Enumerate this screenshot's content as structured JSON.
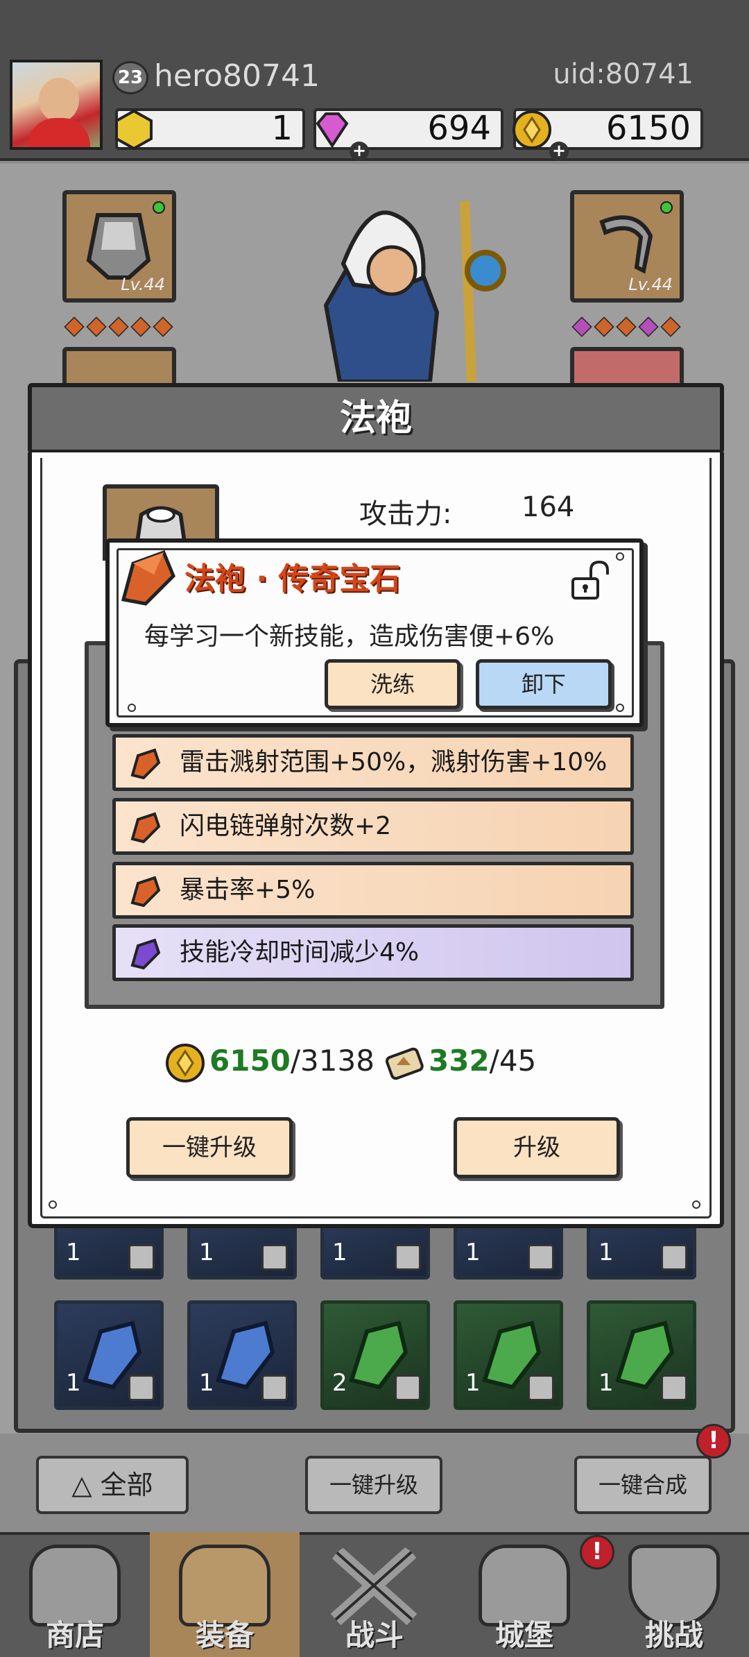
{
  "header": {
    "level": "23",
    "username": "hero80741",
    "uid": "uid:80741",
    "resources": [
      {
        "name": "stamina",
        "value": "1",
        "color": "#e9c832"
      },
      {
        "name": "gem",
        "value": "694",
        "color": "#d65ad0"
      },
      {
        "name": "gold",
        "value": "6150",
        "color": "#e5b21f"
      }
    ]
  },
  "equipment": {
    "left_slot_level": "Lv.44",
    "right_slot_level": "Lv.44"
  },
  "dialog": {
    "title": "法袍",
    "attack_label": "攻击力:",
    "attack_value": "164",
    "gem_popup": {
      "title": "法袍 · 传奇宝石",
      "description": "每学习一个新技能，造成伤害便+6%",
      "refine_label": "洗练",
      "unequip_label": "卸下"
    },
    "gem_rows": [
      {
        "text": "雷击溅射范围+50%，溅射伤害+10%",
        "rarity": "orange"
      },
      {
        "text": "闪电链弹射次数+2",
        "rarity": "orange"
      },
      {
        "text": "暴击率+5%",
        "rarity": "orange"
      },
      {
        "text": "技能冷却时间减少4%",
        "rarity": "purple"
      }
    ],
    "cost": {
      "gold_have": "6150",
      "gold_need": "/3138",
      "scroll_have": "332",
      "scroll_need": "/45"
    },
    "one_key_upgrade_label": "一键升级",
    "upgrade_label": "升级"
  },
  "inventory": {
    "tiles_row1_counts": [
      "1",
      "1",
      "1",
      "1",
      "1"
    ],
    "tiles_row2": [
      {
        "count": "1",
        "color": "blue"
      },
      {
        "count": "1",
        "color": "blue"
      },
      {
        "count": "2",
        "color": "green"
      },
      {
        "count": "1",
        "color": "green"
      },
      {
        "count": "1",
        "color": "green"
      }
    ],
    "filter_label": "全部",
    "upgrade_all_label": "一键升级",
    "merge_all_label": "一键合成",
    "alert_mark": "!"
  },
  "nav": [
    {
      "label": "商店",
      "active": false
    },
    {
      "label": "装备",
      "active": true
    },
    {
      "label": "战斗",
      "active": false
    },
    {
      "label": "城堡",
      "active": false
    },
    {
      "label": "挑战",
      "active": false
    }
  ],
  "colors": {
    "legendary_orange": "#d4461a",
    "have_green": "#1e7a24",
    "button_cream": "#fbe2c2",
    "button_blue": "#b8d8f6"
  }
}
